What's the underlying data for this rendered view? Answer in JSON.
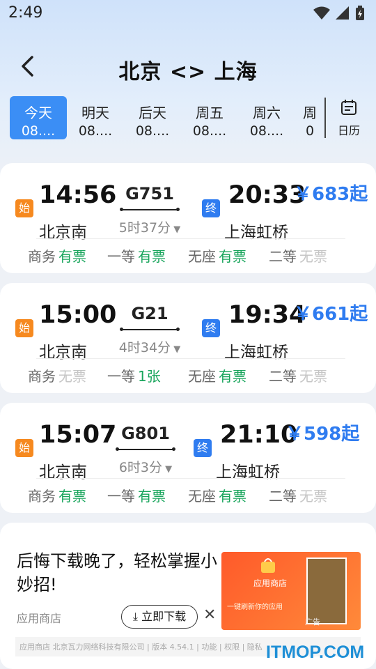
{
  "status_bar": {
    "time": "2:49"
  },
  "header": {
    "title": "北京 <> 上海"
  },
  "dates": [
    {
      "day": "今天",
      "date": "08....",
      "active": true
    },
    {
      "day": "明天",
      "date": "08...."
    },
    {
      "day": "后天",
      "date": "08...."
    },
    {
      "day": "周五",
      "date": "08...."
    },
    {
      "day": "周六",
      "date": "08...."
    },
    {
      "day": "周",
      "date": "0"
    }
  ],
  "calendar_label": "日历",
  "trains": [
    {
      "start_tag": "始",
      "end_tag": "终",
      "dep_time": "14:56",
      "train_no": "G751",
      "arr_time": "20:33",
      "duration": "5时37分",
      "from": "北京南",
      "to": "上海虹桥",
      "price": "￥683起",
      "seats": [
        {
          "class": "商务",
          "status": "有票"
        },
        {
          "class": "一等",
          "status": "有票"
        },
        {
          "class": "无座",
          "status": "有票"
        },
        {
          "class": "二等",
          "status": "无票"
        }
      ]
    },
    {
      "start_tag": "始",
      "end_tag": "终",
      "dep_time": "15:00",
      "train_no": "G21",
      "arr_time": "19:34",
      "duration": "4时34分",
      "from": "北京南",
      "to": "上海虹桥",
      "price": "￥661起",
      "seats": [
        {
          "class": "商务",
          "status": "无票"
        },
        {
          "class": "一等",
          "status": "1张"
        },
        {
          "class": "无座",
          "status": "有票"
        },
        {
          "class": "二等",
          "status": "无票"
        }
      ]
    },
    {
      "start_tag": "始",
      "end_tag": "终",
      "dep_time": "15:07",
      "train_no": "G801",
      "arr_time": "21:10",
      "duration": "6时3分",
      "from": "北京南",
      "to": "上海虹桥",
      "price": "￥598起",
      "seats": [
        {
          "class": "商务",
          "status": "有票"
        },
        {
          "class": "一等",
          "status": "有票"
        },
        {
          "class": "无座",
          "status": "有票"
        },
        {
          "class": "二等",
          "status": "无票"
        }
      ]
    }
  ],
  "ad": {
    "text": "后悔下载晚了，轻松掌握小妙招!",
    "source": "应用商店",
    "download": "立即下载",
    "close": "✕",
    "image_store": "应用商店",
    "image_banner": "一键刷新你的应用",
    "image_label": "广告",
    "footer": "应用商店 北京瓦力网络科技有限公司 | 版本 4.54.1 | 功能 | 权限 | 隐私"
  },
  "watermark": "ITMOP.COM",
  "colors": {
    "accent": "#2f7cf0",
    "available": "#19a55c",
    "unavailable": "#c6c6c6",
    "start_tag": "#f6891f"
  }
}
